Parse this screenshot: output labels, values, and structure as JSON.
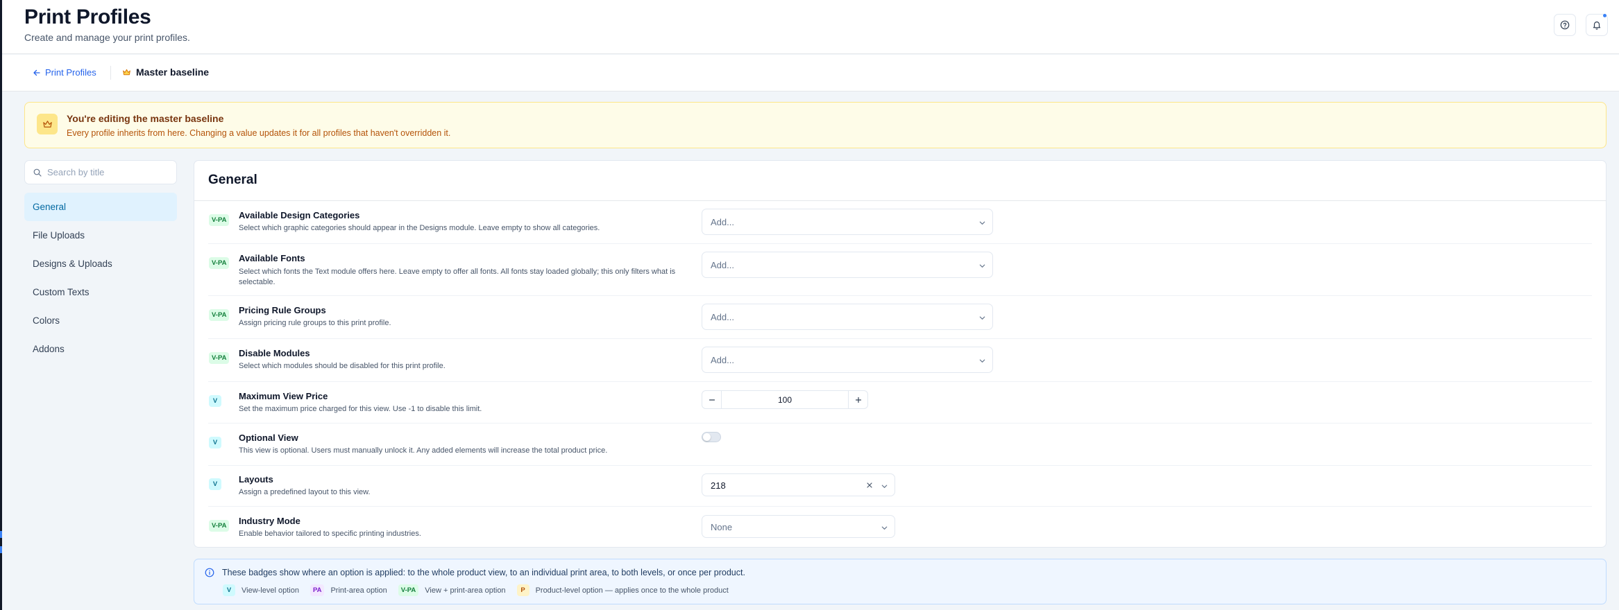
{
  "header": {
    "title": "Print Profiles",
    "subtitle": "Create and manage your print profiles."
  },
  "breadcrumb": {
    "back_label": "Print Profiles",
    "current_label": "Master baseline"
  },
  "banner": {
    "title": "You're editing the master baseline",
    "description": "Every profile inherits from here. Changing a value updates it for all profiles that haven't overridden it."
  },
  "sidebar": {
    "search_placeholder": "Search by title",
    "items": [
      {
        "label": "General",
        "active": true
      },
      {
        "label": "File Uploads"
      },
      {
        "label": "Designs & Uploads"
      },
      {
        "label": "Custom Texts"
      },
      {
        "label": "Colors"
      },
      {
        "label": "Addons"
      }
    ]
  },
  "main": {
    "title": "General",
    "options": [
      {
        "badge": "V-PA",
        "title": "Available Design Categories",
        "description": "Select which graphic categories should appear in the Designs module. Leave empty to show all categories.",
        "control": "select",
        "value": "Add..."
      },
      {
        "badge": "V-PA",
        "title": "Available Fonts",
        "description": "Select which fonts the Text module offers here. Leave empty to offer all fonts. All fonts stay loaded globally; this only filters what is selectable.",
        "control": "select",
        "value": "Add..."
      },
      {
        "badge": "V-PA",
        "title": "Pricing Rule Groups",
        "description": "Assign pricing rule groups to this print profile.",
        "control": "select",
        "value": "Add..."
      },
      {
        "badge": "V-PA",
        "title": "Disable Modules",
        "description": "Select which modules should be disabled for this print profile.",
        "control": "select",
        "value": "Add..."
      },
      {
        "badge": "V",
        "title": "Maximum View Price",
        "description": "Set the maximum price charged for this view. Use -1 to disable this limit.",
        "control": "stepper",
        "value": "100"
      },
      {
        "badge": "V",
        "title": "Optional View",
        "description": "This view is optional. Users must manually unlock it. Any added elements will increase the total product price.",
        "control": "toggle",
        "value": false
      },
      {
        "badge": "V",
        "title": "Layouts",
        "description": "Assign a predefined layout to this view.",
        "control": "select-clear",
        "value": "218"
      },
      {
        "badge": "V-PA",
        "title": "Industry Mode",
        "description": "Enable behavior tailored to specific printing industries.",
        "control": "select-small",
        "value": "None"
      }
    ]
  },
  "legend": {
    "text": "These badges show where an option is applied: to the whole product view, to an individual print area, to both levels, or once per product.",
    "items": [
      {
        "badge": "V",
        "label": "View-level option"
      },
      {
        "badge": "PA",
        "label": "Print-area option"
      },
      {
        "badge": "V-PA",
        "label": "View + print-area option"
      },
      {
        "badge": "P",
        "label": "Product-level option — applies once to the whole product"
      }
    ]
  },
  "colors": {
    "accent": "#2563eb",
    "active_nav_bg": "#e0f2fe",
    "banner_bg": "#fefce8",
    "badge_vpa": "#dcfce7",
    "badge_v": "#cffafe",
    "badge_pa": "#f3e8ff",
    "badge_p": "#fef3c7"
  }
}
